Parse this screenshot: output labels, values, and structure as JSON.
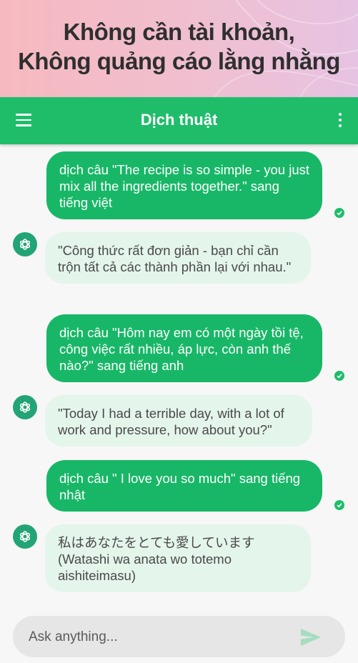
{
  "promo": {
    "line1": "Không cần tài khoản,",
    "line2": "Không quảng cáo lằng nhằng"
  },
  "header": {
    "title": "Dịch thuật",
    "menu_icon": "hamburger-menu-icon",
    "more_icon": "more-vertical-icon",
    "color": "#1fbd6a"
  },
  "messages": [
    {
      "role": "user",
      "text": "dịch câu \"The recipe is so simple - you just mix all the ingredients together.\" sang tiếng việt",
      "status": "sent-check"
    },
    {
      "role": "assistant",
      "text": "\"Công thức rất đơn giản - bạn chỉ cần trộn tất cả các thành phần lại với nhau.\"",
      "avatar": "openai-logo-icon"
    },
    {
      "role": "user",
      "text": "dịch câu \"Hôm nay em có một ngày tồi tệ, công việc rất nhiều, áp lực, còn anh thế nào?\" sang tiếng anh",
      "status": "sent-check"
    },
    {
      "role": "assistant",
      "text": "\"Today I had a terrible day, with a lot of work and pressure, how about you?\"",
      "avatar": "openai-logo-icon"
    },
    {
      "role": "user",
      "text": "dịch câu \" I love you so much\" sang tiếng nhật",
      "status": "sent-check"
    },
    {
      "role": "assistant",
      "text": "私はあなたをとても愛しています (Watashi wa anata wo totemo aishiteimasu)",
      "avatar": "openai-logo-icon"
    }
  ],
  "input": {
    "placeholder": "Ask anything...",
    "value": "",
    "send_icon": "send-icon"
  },
  "colors": {
    "user_bubble": "#18b767",
    "assistant_bubble": "#e4f5eb",
    "avatar": "#23a476"
  }
}
